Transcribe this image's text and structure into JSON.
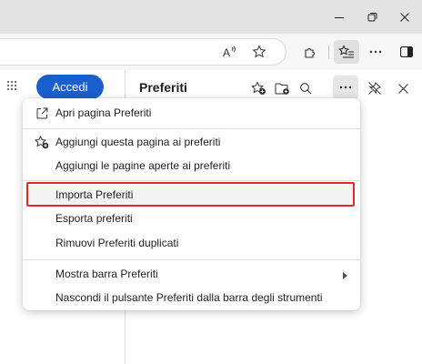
{
  "window": {
    "minimize_icon": "minimize-icon",
    "maximize_icon": "restore-icon",
    "close_icon": "close-icon"
  },
  "toolbar": {
    "icons": [
      "read-aloud-icon",
      "favorite-star-icon",
      "extensions-icon",
      "favorites-collection-icon",
      "more-icon",
      "sidebar-icon"
    ]
  },
  "sidebar": {
    "signin_label": "Accedi"
  },
  "favorites_pane": {
    "title": "Preferiti"
  },
  "menu": {
    "items": [
      {
        "label": "Apri pagina Preferiti",
        "icon": "open-external-icon"
      },
      {
        "label": "Aggiungi questa pagina ai preferiti",
        "icon": "add-favorite-icon"
      },
      {
        "label": "Aggiungi le pagine aperte ai preferiti"
      },
      {
        "label": "Importa Preferiti",
        "highlighted": true
      },
      {
        "label": "Esporta preferiti"
      },
      {
        "label": "Rimuovi Preferiti duplicati"
      },
      {
        "label": "Mostra barra Preferiti",
        "submenu": true
      },
      {
        "label": "Nascondi il pulsante Preferiti dalla barra degli strumenti"
      }
    ]
  },
  "colors": {
    "accent": "#1b5fce",
    "highlight_border": "#e02a2a"
  }
}
